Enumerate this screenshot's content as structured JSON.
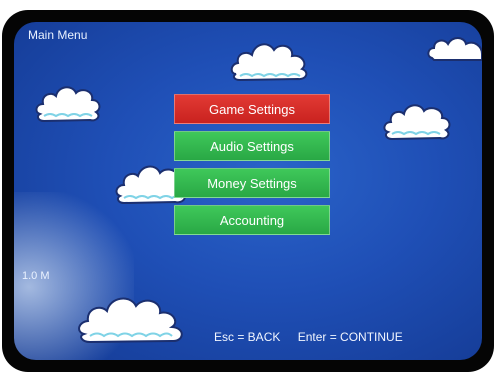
{
  "screen": {
    "title": "Main Menu",
    "version_text": "1.0 M"
  },
  "menu": {
    "items": [
      {
        "label": "Game Settings",
        "selected": true
      },
      {
        "label": "Audio Settings",
        "selected": false
      },
      {
        "label": "Money Settings",
        "selected": false
      },
      {
        "label": "Accounting",
        "selected": false
      }
    ]
  },
  "footer": {
    "back_hint": "Esc = BACK",
    "continue_hint": "Enter = CONTINUE"
  },
  "colors": {
    "background": "#1f4fb6",
    "selected_item": "#d62c28",
    "normal_item": "#33b84f",
    "cloud": "#ffffff",
    "cloud_trim": "#7fd3e6"
  }
}
